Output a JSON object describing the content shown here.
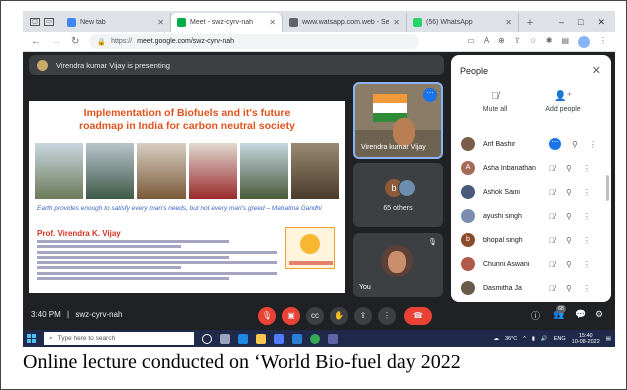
{
  "browser": {
    "tabs": [
      {
        "title": "New tab",
        "fav": "#4285f4",
        "active": false
      },
      {
        "title": "Meet - swz-cyrv-nah",
        "fav": "#00ac47",
        "active": true
      },
      {
        "title": "www.watsapp.com.web - Search",
        "fav": "#5f6368",
        "active": false
      },
      {
        "title": "(56) WhatsApp",
        "fav": "#25d366",
        "active": false
      }
    ],
    "new_tab": "+",
    "window_controls": {
      "minimize": "–",
      "maximize": "□",
      "close": "✕"
    },
    "address": {
      "scheme": "https://",
      "url": "meet.google.com/swz-cyrv-nah"
    }
  },
  "meet": {
    "presenting_banner": "Virendra kumar Vijay is presenting",
    "slide": {
      "title_line1": "Implementation of Biofuels and it's future",
      "title_line2": "roadmap in India for carbon neutral society",
      "quote": "Earth provides enough to satisfy every man's needs, but not every man's greed  –  Mahatma Gandhi",
      "presenter": "Prof. Virendra K. Vijay"
    },
    "tiles": {
      "speaker_name": "Virendra kumar Vijay",
      "others_initial": "b",
      "others_label": "65 others",
      "self_label": "You"
    },
    "meeting_time": "3:40 PM",
    "separator": "|",
    "meeting_code": "swz-cyrv-nah",
    "participant_badge": "68"
  },
  "people_panel": {
    "title": "People",
    "mute_all": "Mute all",
    "add_people": "Add people",
    "participants": [
      {
        "name": "Arif Bashir",
        "initial": "",
        "color": "#7b5e4a",
        "speaking": true
      },
      {
        "name": "Asha Inbanathan",
        "initial": "A",
        "color": "#a56a5a",
        "speaking": false
      },
      {
        "name": "Ashok Saini",
        "initial": "",
        "color": "#4a5a7a",
        "speaking": false
      },
      {
        "name": "ayushi singh",
        "initial": "",
        "color": "#7a8fb0",
        "speaking": false
      },
      {
        "name": "bhopal singh",
        "initial": "b",
        "color": "#8d4a2a",
        "speaking": false
      },
      {
        "name": "Chunni Aswani",
        "initial": "",
        "color": "#b05a4a",
        "speaking": false
      },
      {
        "name": "Dasmitha Ja",
        "initial": "",
        "color": "#6a5a4a",
        "speaking": false
      }
    ]
  },
  "taskbar": {
    "search_placeholder": "Type here to search",
    "temperature": "36°C",
    "language": "ENG",
    "time": "15:40",
    "date": "10-08-2022"
  },
  "caption": "Online lecture conducted on ‘World Bio-fuel day 2022"
}
